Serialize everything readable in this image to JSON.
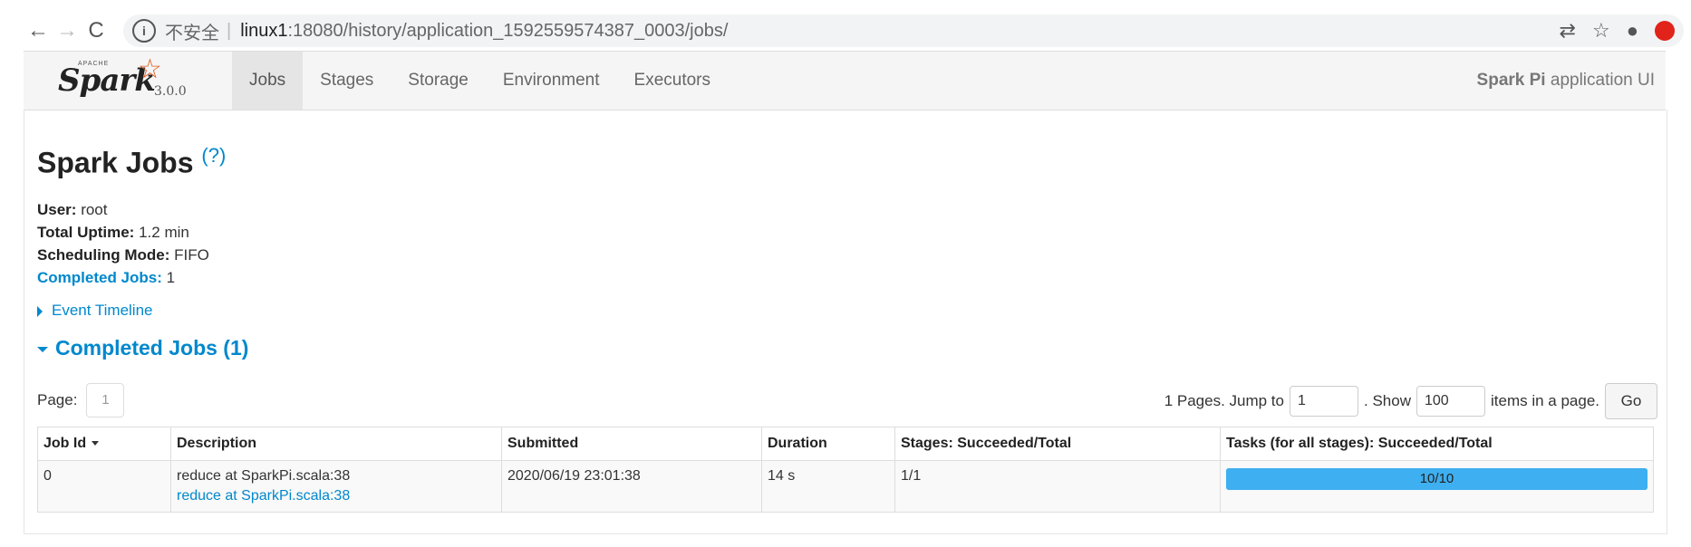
{
  "browser": {
    "back": "←",
    "forward": "→",
    "reload": "C",
    "info": "i",
    "insecure": "不安全",
    "separator": "|",
    "host": "linux1",
    "path": ":18080/history/application_1592559574387_0003/jobs/",
    "actions": {
      "translate": "⇄",
      "star": "☆",
      "account": "●"
    }
  },
  "brand": {
    "apache": "APACHE",
    "name": "Spark",
    "version": "3.0.0"
  },
  "nav": {
    "tabs": [
      "Jobs",
      "Stages",
      "Storage",
      "Environment",
      "Executors"
    ],
    "active_tab": "Jobs",
    "app_name": "Spark Pi",
    "app_suffix": " application UI"
  },
  "page": {
    "title": "Spark Jobs",
    "help": "(?)",
    "summary": {
      "user_label": "User:",
      "user": " root",
      "uptime_label": "Total Uptime:",
      "uptime": " 1.2 min",
      "mode_label": "Scheduling Mode:",
      "mode": " FIFO",
      "completed_label": "Completed Jobs:",
      "completed": " 1"
    },
    "event_timeline": "Event Timeline",
    "completed_header": "Completed Jobs (1)"
  },
  "pager": {
    "page_label": "Page:",
    "current_page": "1",
    "pages_text": "1 Pages. Jump to",
    "jump_value": "1",
    "show_label": ". Show",
    "show_value": "100",
    "items_label": "items in a page.",
    "go_label": "Go"
  },
  "table": {
    "headers": [
      "Job Id",
      "Description",
      "Submitted",
      "Duration",
      "Stages: Succeeded/Total",
      "Tasks (for all stages): Succeeded/Total"
    ],
    "rows": [
      {
        "job_id": "0",
        "desc_text": "reduce at SparkPi.scala:38",
        "desc_link": "reduce at SparkPi.scala:38",
        "submitted": "2020/06/19 23:01:38",
        "duration": "14 s",
        "stages": "1/1",
        "tasks": "10/10",
        "tasks_progress_percent": 100
      }
    ]
  },
  "colors": {
    "link": "#0088cc",
    "progress": "#3eaff0",
    "spark_orange": "#e25a1c"
  }
}
